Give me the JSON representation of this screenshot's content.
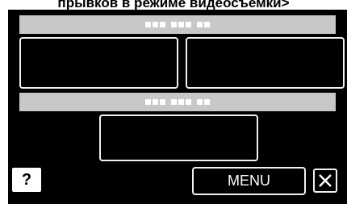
{
  "header": {
    "caption": "прывков в режиме видеосъемки>"
  },
  "top_bar": {
    "label_groups": [
      3,
      3,
      2
    ]
  },
  "mid_bar": {
    "label_groups": [
      3,
      3,
      2
    ]
  },
  "buttons": {
    "top_left_label": "",
    "top_right_label": "",
    "center_label": "",
    "menu_label": "MENU",
    "help_label": "?",
    "close_icon": "close-icon"
  },
  "colors": {
    "screen_bg": "#000000",
    "bar": "#c8c8c8",
    "button_border": "#f0f0f0"
  }
}
